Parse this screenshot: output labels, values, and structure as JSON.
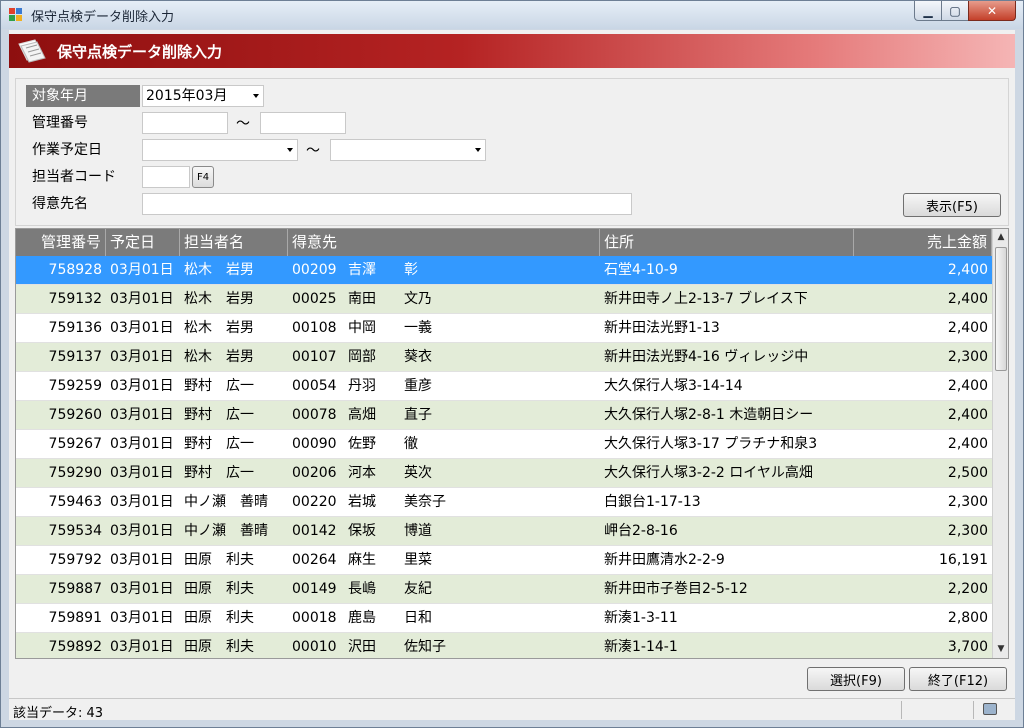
{
  "window": {
    "title": "保守点検データ削除入力",
    "minimize": "▁",
    "maximize": "▢",
    "close": "✕"
  },
  "header": {
    "title": "保守点検データ削除入力",
    "icon": "document-icon"
  },
  "search": {
    "target_month_label": "対象年月",
    "target_month_value": "2015年03月",
    "mgmt_no_label": "管理番号",
    "tilde": "～",
    "sched_date_label": "作業予定日",
    "staff_code_label": "担当者コード",
    "f4_label": "F4",
    "customer_name_label": "得意先名",
    "show_button": "表示(F5)"
  },
  "grid": {
    "columns": [
      "管理番号",
      "予定日",
      "担当者名",
      "得意先",
      "住所",
      "売上金額"
    ],
    "rows": [
      {
        "id": "758928",
        "date": "03月01日",
        "staff": "松木　岩男",
        "cust_code": "00209",
        "cust": "吉澤　　彰",
        "addr": "石堂4-10-9",
        "amt": "2,400"
      },
      {
        "id": "759132",
        "date": "03月01日",
        "staff": "松木　岩男",
        "cust_code": "00025",
        "cust": "南田　　文乃",
        "addr": "新井田寺ノ上2-13-7 ブレイス下",
        "amt": "2,400"
      },
      {
        "id": "759136",
        "date": "03月01日",
        "staff": "松木　岩男",
        "cust_code": "00108",
        "cust": "中岡　　一義",
        "addr": "新井田法光野1-13",
        "amt": "2,400"
      },
      {
        "id": "759137",
        "date": "03月01日",
        "staff": "松木　岩男",
        "cust_code": "00107",
        "cust": "岡部　　葵衣",
        "addr": "新井田法光野4-16 ヴィレッジ中",
        "amt": "2,300"
      },
      {
        "id": "759259",
        "date": "03月01日",
        "staff": "野村　広一",
        "cust_code": "00054",
        "cust": "丹羽　　重彦",
        "addr": "大久保行人塚3-14-14",
        "amt": "2,400"
      },
      {
        "id": "759260",
        "date": "03月01日",
        "staff": "野村　広一",
        "cust_code": "00078",
        "cust": "高畑　　直子",
        "addr": "大久保行人塚2-8-1 木造朝日シー",
        "amt": "2,400"
      },
      {
        "id": "759267",
        "date": "03月01日",
        "staff": "野村　広一",
        "cust_code": "00090",
        "cust": "佐野　　徹",
        "addr": "大久保行人塚3-17 プラチナ和泉3",
        "amt": "2,400"
      },
      {
        "id": "759290",
        "date": "03月01日",
        "staff": "野村　広一",
        "cust_code": "00206",
        "cust": "河本　　英次",
        "addr": "大久保行人塚3-2-2 ロイヤル高畑",
        "amt": "2,500"
      },
      {
        "id": "759463",
        "date": "03月01日",
        "staff": "中ノ瀬　善晴",
        "cust_code": "00220",
        "cust": "岩城　　美奈子",
        "addr": "白銀台1-17-13",
        "amt": "2,300"
      },
      {
        "id": "759534",
        "date": "03月01日",
        "staff": "中ノ瀬　善晴",
        "cust_code": "00142",
        "cust": "保坂　　博道",
        "addr": "岬台2-8-16",
        "amt": "2,300"
      },
      {
        "id": "759792",
        "date": "03月01日",
        "staff": "田原　利夫",
        "cust_code": "00264",
        "cust": "麻生　　里菜",
        "addr": "新井田鷹清水2-2-9",
        "amt": "16,191"
      },
      {
        "id": "759887",
        "date": "03月01日",
        "staff": "田原　利夫",
        "cust_code": "00149",
        "cust": "長嶋　　友紀",
        "addr": "新井田市子巻目2-5-12",
        "amt": "2,200"
      },
      {
        "id": "759891",
        "date": "03月01日",
        "staff": "田原　利夫",
        "cust_code": "00018",
        "cust": "鹿島　　日和",
        "addr": "新湊1-3-11",
        "amt": "2,800"
      },
      {
        "id": "759892",
        "date": "03月01日",
        "staff": "田原　利夫",
        "cust_code": "00010",
        "cust": "沢田　　佐知子",
        "addr": "新湊1-14-1",
        "amt": "3,700"
      }
    ]
  },
  "buttons": {
    "select": "選択(F9)",
    "exit": "終了(F12)"
  },
  "status": {
    "text": "該当データ: 43"
  },
  "colors": {
    "header_dark": "#8e0f0f",
    "selected_row": "#3399ff",
    "alt_row": "#e3ecd8"
  }
}
